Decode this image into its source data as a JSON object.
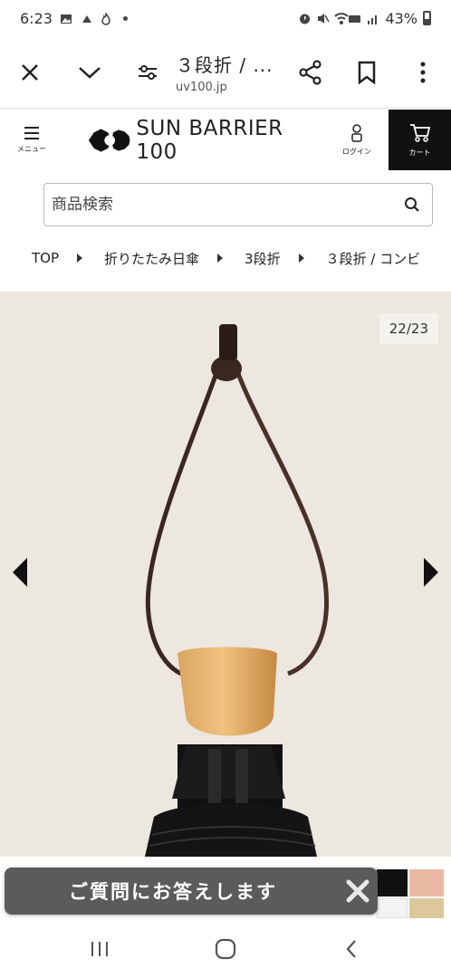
{
  "status_bar": {
    "time": "6:23",
    "battery": "43%"
  },
  "browser": {
    "title": "３段折 / ...",
    "url": "uv100.jp"
  },
  "header": {
    "menu_label": "メニュー",
    "logo_text": "SUN BARRIER 100",
    "login_label": "ログイン",
    "cart_label": "カート"
  },
  "search": {
    "placeholder": "商品検索"
  },
  "breadcrumb": [
    "TOP",
    "折りたたみ日傘",
    "3段折",
    "３段折 / コンビ"
  ],
  "gallery": {
    "counter": "22/23"
  },
  "chat": {
    "text": "ご質問にお答えします"
  }
}
